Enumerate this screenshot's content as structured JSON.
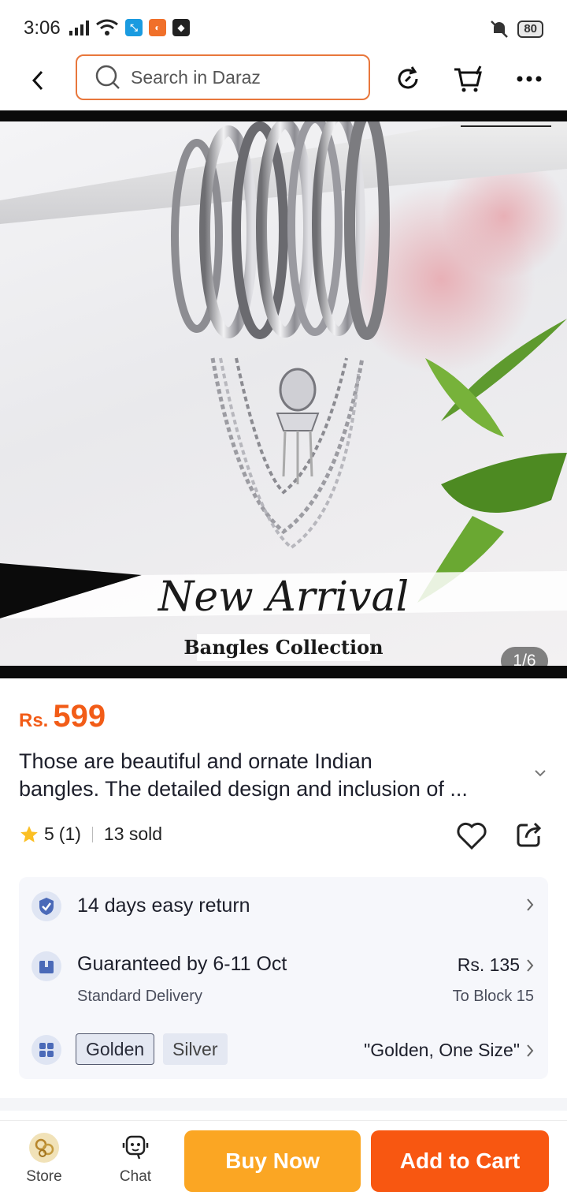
{
  "status": {
    "time": "3:06",
    "battery": "80"
  },
  "search": {
    "placeholder": "Search in Daraz"
  },
  "hero": {
    "headline": "New Arrival",
    "subheadline": "Bangles Collection",
    "counter": "1/6"
  },
  "product": {
    "currency": "Rs.",
    "price": "599",
    "title_line1": "Those are beautiful and ornate Indian",
    "title_line2": "bangles. The detailed design and inclusion of ...",
    "rating": "5",
    "rating_count": "(1)",
    "sold": "13 sold"
  },
  "info": {
    "return_text": "14 days easy return",
    "delivery_text": "Guaranteed by 6-11 Oct",
    "delivery_sub": "Standard Delivery",
    "delivery_fee": "Rs. 135",
    "delivery_to": "To Block 15",
    "variant_options": [
      "Golden",
      "Silver"
    ],
    "variant_selected": "\"Golden, One Size\""
  },
  "bottom": {
    "store_label": "Store",
    "chat_label": "Chat",
    "buy_now": "Buy Now",
    "add_to_cart": "Add to Cart"
  },
  "colors": {
    "accent": "#f25c17",
    "buy": "#fba623",
    "cart": "#f85711",
    "search_border": "#e8773c"
  }
}
